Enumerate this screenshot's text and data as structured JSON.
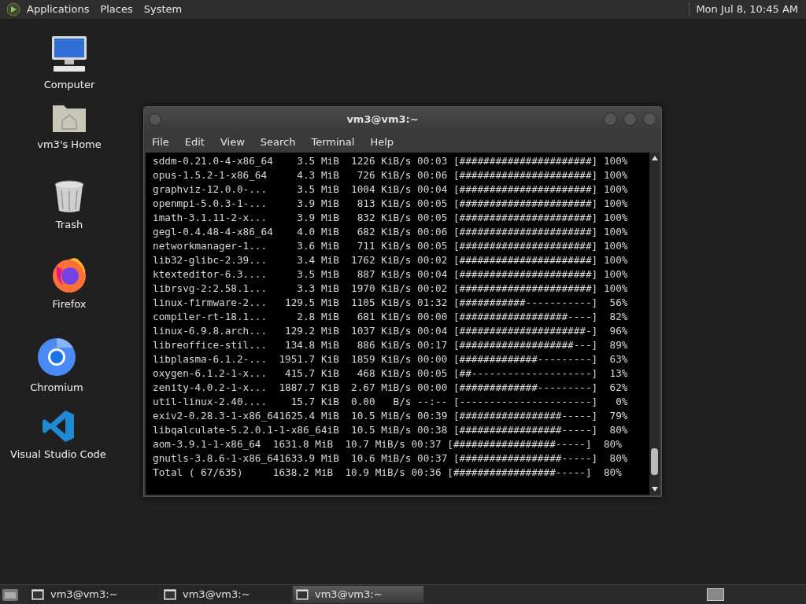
{
  "top_panel": {
    "menus": [
      "Applications",
      "Places",
      "System"
    ],
    "clock": "Mon Jul 8, 10:45 AM"
  },
  "desktop_icons": [
    {
      "label": "Computer",
      "kind": "computer"
    },
    {
      "label": "vm3's Home",
      "kind": "home"
    },
    {
      "label": "Trash",
      "kind": "trash"
    },
    {
      "label": "Firefox",
      "kind": "firefox"
    },
    {
      "label": "Chromium",
      "kind": "chromium"
    },
    {
      "label": "Visual Studio Code",
      "kind": "vscode"
    }
  ],
  "window": {
    "title": "vm3@vm3:~",
    "menu": [
      "File",
      "Edit",
      "View",
      "Search",
      "Terminal",
      "Help"
    ],
    "lines": [
      "sddm-0.21.0-4-x86_64    3.5 MiB  1226 KiB/s 00:03 [######################] 100%",
      "opus-1.5.2-1-x86_64     4.3 MiB   726 KiB/s 00:06 [######################] 100%",
      "graphviz-12.0.0-...     3.5 MiB  1004 KiB/s 00:04 [######################] 100%",
      "openmpi-5.0.3-1-...     3.9 MiB   813 KiB/s 00:05 [######################] 100%",
      "imath-3.1.11-2-x...     3.9 MiB   832 KiB/s 00:05 [######################] 100%",
      "gegl-0.4.48-4-x86_64    4.0 MiB   682 KiB/s 00:06 [######################] 100%",
      "networkmanager-1...     3.6 MiB   711 KiB/s 00:05 [######################] 100%",
      "lib32-glibc-2.39...     3.4 MiB  1762 KiB/s 00:02 [######################] 100%",
      "ktexteditor-6.3....     3.5 MiB   887 KiB/s 00:04 [######################] 100%",
      "librsvg-2:2.58.1...     3.3 MiB  1970 KiB/s 00:02 [######################] 100%",
      "linux-firmware-2...   129.5 MiB  1105 KiB/s 01:32 [###########-----------]  56%",
      "compiler-rt-18.1...     2.8 MiB   681 KiB/s 00:00 [##################----]  82%",
      "linux-6.9.8.arch...   129.2 MiB  1037 KiB/s 00:04 [#####################-]  96%",
      "libreoffice-stil...   134.8 MiB   886 KiB/s 00:17 [###################---]  89%",
      "libplasma-6.1.2-...  1951.7 KiB  1859 KiB/s 00:00 [#############---------]  63%",
      "oxygen-6.1.2-1-x...   415.7 KiB   468 KiB/s 00:05 [##--------------------]  13%",
      "zenity-4.0.2-1-x...  1887.7 KiB  2.67 MiB/s 00:00 [#############---------]  62%",
      "util-linux-2.40....    15.7 KiB  0.00   B/s --:-- [----------------------]   0%",
      "exiv2-0.28.3-1-x86_641625.4 MiB  10.5 MiB/s 00:39 [#################-----]  79%",
      "libqalculate-5.2.0.1-1-x86_64iB  10.5 MiB/s 00:38 [#################-----]  80%",
      "aom-3.9.1-1-x86_64  1631.8 MiB  10.7 MiB/s 00:37 [#################-----]  80%",
      "gnutls-3.8.6-1-x86_641633.9 MiB  10.6 MiB/s 00:37 [#################-----]  80%",
      "Total ( 67/635)     1638.2 MiB  10.9 MiB/s 00:36 [#################-----]  80%"
    ]
  },
  "taskbar": {
    "tasks": [
      {
        "label": "vm3@vm3:~",
        "selected": false
      },
      {
        "label": "vm3@vm3:~",
        "selected": false
      },
      {
        "label": "vm3@vm3:~",
        "selected": true
      }
    ]
  }
}
